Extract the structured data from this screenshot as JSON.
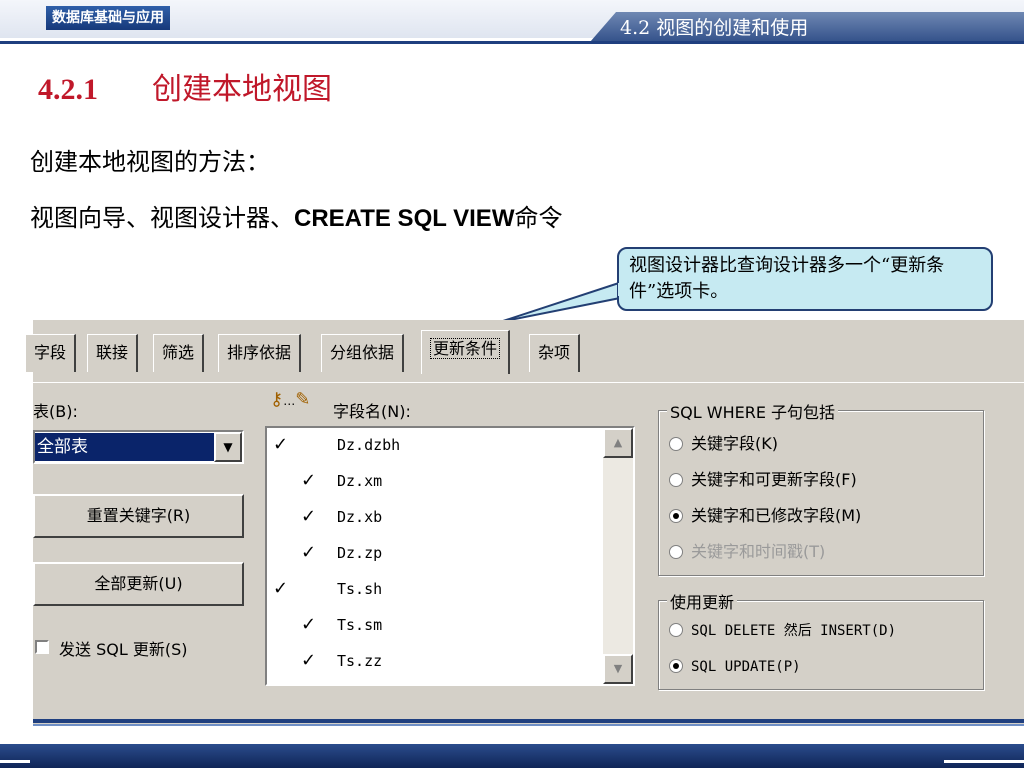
{
  "header": {
    "course_title": "数据库基础与应用",
    "section_title": "4.2  视图的创建和使用"
  },
  "slide": {
    "title_number": "4.2.1",
    "title_text": "创建本地视图",
    "line1": "创建本地视图的方法：",
    "line2_cn": "视图向导、视图设计器、",
    "line2_latin": "CREATE SQL VIEW",
    "line2_end": "命令",
    "callout": "视图设计器比查询设计器多一个“更新条件”选项卡。"
  },
  "dialog": {
    "tabs": [
      {
        "label": "字段"
      },
      {
        "label": "联接"
      },
      {
        "label": "筛选"
      },
      {
        "label": "排序依据"
      },
      {
        "label": "分组依据"
      },
      {
        "label": "更新条件"
      },
      {
        "label": "杂项"
      }
    ],
    "active_tab": "更新条件",
    "table_label": "表(B):",
    "table_value": "全部表",
    "reset_key_button": "重置关键字(R)",
    "update_all_button": "全部更新(U)",
    "send_sql_update": "发送 SQL 更新(S)",
    "send_sql_update_checked": false,
    "field_name_label": "字段名(N):",
    "fields": [
      {
        "key": true,
        "updatable": false,
        "name": "Dz.dzbh"
      },
      {
        "key": false,
        "updatable": true,
        "name": "Dz.xm"
      },
      {
        "key": false,
        "updatable": true,
        "name": "Dz.xb"
      },
      {
        "key": false,
        "updatable": true,
        "name": "Dz.zp"
      },
      {
        "key": true,
        "updatable": false,
        "name": "Ts.sh"
      },
      {
        "key": false,
        "updatable": true,
        "name": "Ts.sm"
      },
      {
        "key": false,
        "updatable": true,
        "name": "Ts.zz"
      }
    ],
    "where_group": {
      "legend": "SQL WHERE 子句包括",
      "options": [
        {
          "label": "关键字段(K)",
          "selected": false,
          "disabled": false
        },
        {
          "label": "关键字和可更新字段(F)",
          "selected": false,
          "disabled": false
        },
        {
          "label": "关键字和已修改字段(M)",
          "selected": true,
          "disabled": false
        },
        {
          "label": "关键字和时间戳(T)",
          "selected": false,
          "disabled": true
        }
      ]
    },
    "update_group": {
      "legend": "使用更新",
      "options": [
        {
          "label": "SQL DELETE 然后 INSERT(D)",
          "selected": false
        },
        {
          "label": "SQL UPDATE(P)",
          "selected": true
        }
      ]
    },
    "check_glyph": "✓",
    "combo_arrow": "▼",
    "scroll_up": "▲",
    "scroll_down": "▼",
    "key_glyph": "⚷",
    "pencil_glyph": "✎",
    "ellipsis": "…"
  },
  "colors": {
    "title_red": "#c0182a",
    "header_blue": "#1f3f7f",
    "callout_fill": "#c6eaf2",
    "dialog_face": "#d4d0c8",
    "selection_blue": "#0a246a"
  }
}
